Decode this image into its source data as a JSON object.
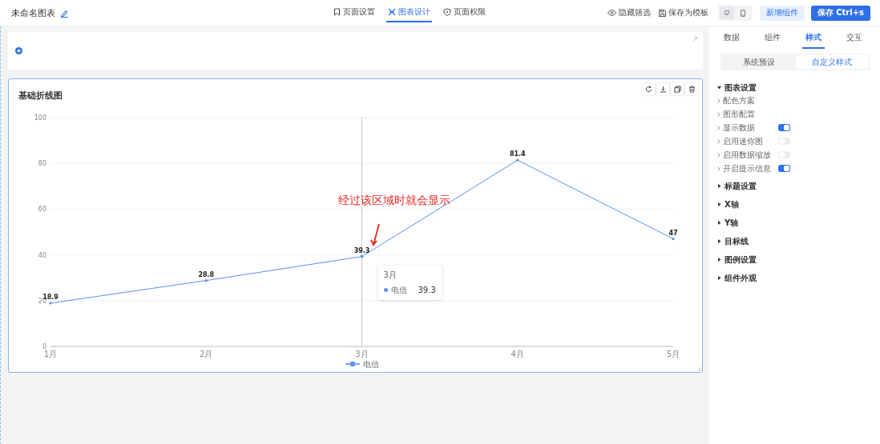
{
  "header": {
    "title": "未命名图表",
    "tabs": [
      {
        "label": "页面设置",
        "selected": false
      },
      {
        "label": "图表设计",
        "selected": true
      },
      {
        "label": "页面权限",
        "selected": false
      }
    ],
    "actions": [
      "隐藏筛选",
      "保存为模板"
    ],
    "devices": [
      {
        "selected": true
      },
      {
        "selected": false
      }
    ],
    "buttons": [
      {
        "label": "新增组件",
        "kind": "secondary"
      },
      {
        "label": "保存 Ctrl+s",
        "kind": "primary"
      }
    ]
  },
  "chart_card": {
    "title": "基础折线图",
    "chart_data": {
      "type": "line",
      "categories": [
        "1月",
        "2月",
        "3月",
        "4月",
        "5月"
      ],
      "series": [
        {
          "name": "电信",
          "color": "#5b8ff9",
          "values": [
            18.9,
            28.8,
            39.3,
            81.4,
            47
          ]
        }
      ],
      "ylim": [
        0,
        100
      ],
      "yticks": [
        0,
        20,
        40,
        60,
        80,
        100
      ],
      "grid": true,
      "data_labels": true,
      "ref_lines": [
        {
          "axis": "x",
          "value": "3月"
        }
      ]
    },
    "value_labels": [
      "18.9",
      "28.8",
      "39.3",
      "81.4",
      "47"
    ],
    "hovered_points": [
      false,
      false,
      true,
      false,
      false
    ],
    "tooltip": {
      "title": "3月",
      "rows": [
        {
          "name": "电信",
          "value": "39.3",
          "color": "#5b8ff9"
        }
      ]
    },
    "annotation": "经过该区域时就会显示"
  },
  "panel": {
    "tabs": [
      {
        "label": "数据",
        "selected": false
      },
      {
        "label": "组件",
        "selected": false
      },
      {
        "label": "样式",
        "selected": true
      },
      {
        "label": "交互",
        "selected": false
      }
    ],
    "segments": [
      {
        "label": "系统预设",
        "selected": false
      },
      {
        "label": "自定义样式",
        "selected": true
      }
    ],
    "sections": [
      {
        "label": "图表设置",
        "expanded": true,
        "items": [
          {
            "label": "配色方案",
            "kind": "item"
          },
          {
            "label": "图形配置",
            "kind": "item"
          },
          {
            "label": "显示数据",
            "kind": "toggle",
            "on": true
          },
          {
            "label": "启用迷你图",
            "kind": "toggle",
            "on": false
          },
          {
            "label": "启用数据缩放",
            "kind": "toggle",
            "on": false
          },
          {
            "label": "开启提示信息",
            "kind": "toggle",
            "on": true
          }
        ]
      },
      {
        "label": "标题设置",
        "expanded": false
      },
      {
        "label": "X轴",
        "expanded": false
      },
      {
        "label": "Y轴",
        "expanded": false
      },
      {
        "label": "目标线",
        "expanded": false
      },
      {
        "label": "图例设置",
        "expanded": false
      },
      {
        "label": "组件外观",
        "expanded": false
      }
    ]
  }
}
